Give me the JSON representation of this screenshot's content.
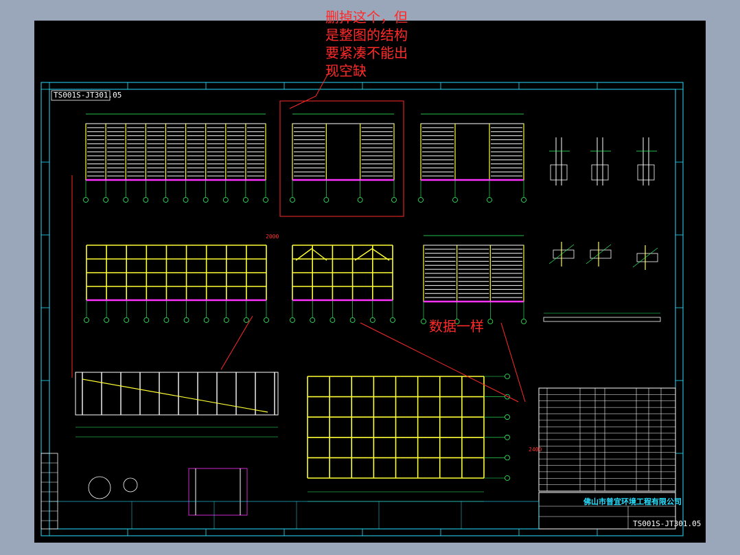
{
  "annotations": {
    "top_note": "删掉这个，但\n是整图的结构\n要紧凑不能出\n现空缺",
    "middle_note": "数据一样"
  },
  "title_block": {
    "corner_code": "TS001S-JT301.05",
    "company": "佛山市普宜环境工程有限公司",
    "drawing_no": "TS001S-JT301.05"
  },
  "dimensions": {
    "elevation_2000": "2000",
    "sub_2400": "2400"
  },
  "colors": {
    "background": "#000000",
    "frame": "#27e0ff",
    "steel": "#ffff33",
    "panel": "#ffffff",
    "dimension": "#ff3333",
    "marker": "#ff33ff",
    "green": "#33ff66",
    "window": "#9aa6b9"
  }
}
